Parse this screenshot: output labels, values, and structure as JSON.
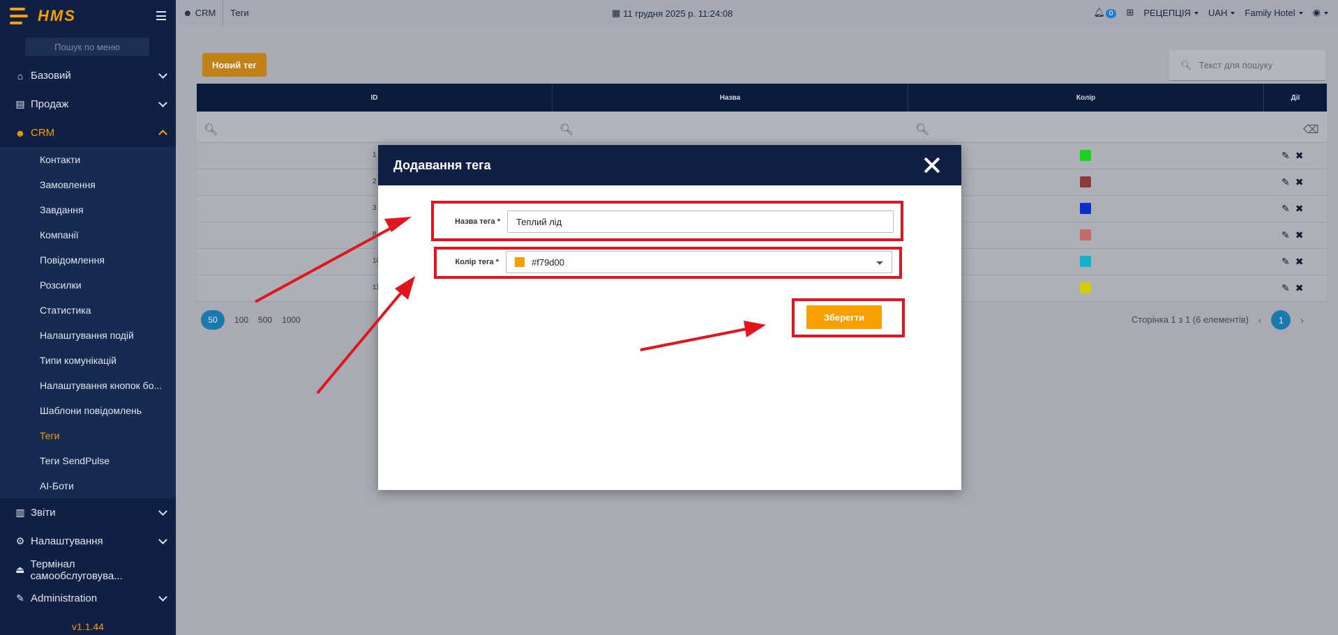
{
  "app": {
    "logo": "HMS",
    "version": "v1.1.44",
    "menu_search_placeholder": "Пошук по меню"
  },
  "sidebar": {
    "items": [
      {
        "label": "Базовий",
        "icon": "home-icon"
      },
      {
        "label": "Продаж",
        "icon": "wallet-icon"
      },
      {
        "label": "CRM",
        "icon": "users-icon",
        "open": true
      },
      {
        "label": "Звіти",
        "icon": "chart-icon"
      },
      {
        "label": "Налаштування",
        "icon": "cogs-icon"
      },
      {
        "label": "Термінал самообслуговува...",
        "icon": "bell-desk-icon"
      },
      {
        "label": "Administration",
        "icon": "wrench-icon"
      }
    ],
    "crm_sub": [
      "Контакти",
      "Замовлення",
      "Завдання",
      "Компанії",
      "Повідомлення",
      "Розсилки",
      "Статистика",
      "Налаштування подій",
      "Типи комунікацій",
      "Налаштування кнопок бо...",
      "Шаблони повідомлень",
      "Теги",
      "Теги SendPulse",
      "AI-Боти"
    ],
    "active_sub": "Теги"
  },
  "topbar": {
    "crumbs": [
      "CRM",
      "Теги"
    ],
    "datetime": "11 грудня 2025 р. 11:24:08",
    "notifications": "0",
    "role": "РЕЦЕПЦІЯ",
    "currency": "UAH",
    "hotel": "Family Hotel"
  },
  "page": {
    "new_tag_label": "Новий тег",
    "search_placeholder": "Текст для пошуку",
    "columns": [
      "ID",
      "Назва",
      "Колір",
      "Дії"
    ],
    "rows": [
      {
        "id": "1",
        "color": "#1ed01e"
      },
      {
        "id": "2",
        "color": "#8c3a3a"
      },
      {
        "id": "3",
        "color": "#0a2ec8"
      },
      {
        "id": "8",
        "color": "#c46a6a"
      },
      {
        "id": "10",
        "color": "#12b3c9"
      },
      {
        "id": "11",
        "color": "#d4cc0a"
      }
    ],
    "page_sizes": [
      "50",
      "100",
      "500",
      "1000"
    ],
    "pager_info": "Сторінка 1 з 1 (6 елементів)",
    "current_page": "1"
  },
  "modal": {
    "title": "Додавання тега",
    "name_label": "Назва тега *",
    "name_value": "Теплий лід",
    "color_label": "Колір тега *",
    "color_value": "#f79d00",
    "save_label": "Зберегти"
  },
  "colors": {
    "sidebar": "#0f2044",
    "accent": "#f7a000",
    "annotation": "#e0161e"
  }
}
